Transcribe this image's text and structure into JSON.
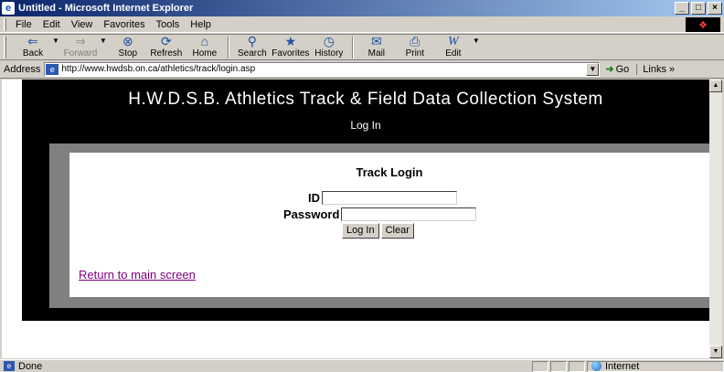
{
  "window": {
    "title": "Untitled - Microsoft Internet Explorer",
    "buttons": [
      "_",
      "□",
      "×"
    ]
  },
  "menu": [
    "File",
    "Edit",
    "View",
    "Favorites",
    "Tools",
    "Help"
  ],
  "toolbar": {
    "back": "Back",
    "forward": "Forward",
    "stop": "Stop",
    "refresh": "Refresh",
    "home": "Home",
    "search": "Search",
    "favorites": "Favorites",
    "history": "History",
    "mail": "Mail",
    "print": "Print",
    "edit": "Edit"
  },
  "address": {
    "label": "Address",
    "url": "http://www.hwdsb.on.ca/athletics/track/login.asp",
    "go": "Go",
    "links": "Links »"
  },
  "page": {
    "heading": "H.W.D.S.B. Athletics Track & Field Data Collection System",
    "subheading": "Log In",
    "login_title": "Track Login",
    "id_label": "ID",
    "password_label": "Password",
    "login_button": "Log In",
    "clear_button": "Clear",
    "return_link": "Return to main screen"
  },
  "status": {
    "text": "Done",
    "zone": "Internet"
  },
  "colors": {
    "title_start": "#0a246a",
    "visited_link": "#800080",
    "banner": "#000000",
    "frame": "#808080"
  }
}
